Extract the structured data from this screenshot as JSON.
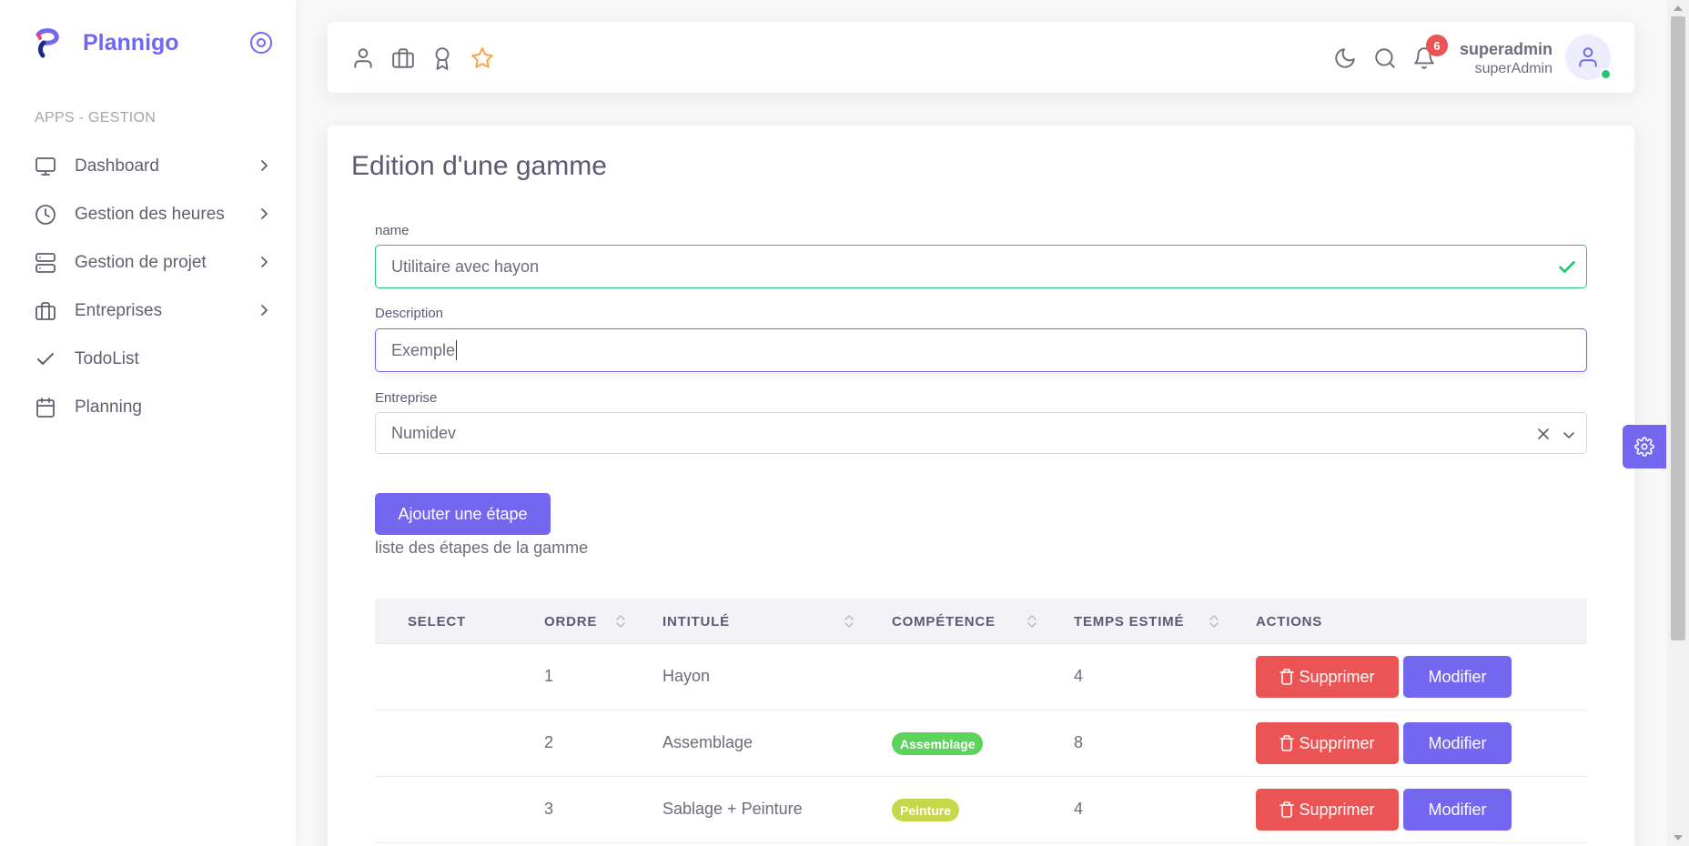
{
  "app": {
    "name": "Plannigo",
    "accent": "#7367f0"
  },
  "sidebar": {
    "section_header": "APPS - GESTION",
    "items": [
      {
        "label": "Dashboard",
        "icon": "monitor-icon",
        "has_children": true
      },
      {
        "label": "Gestion des heures",
        "icon": "clock-icon",
        "has_children": true
      },
      {
        "label": "Gestion de projet",
        "icon": "server-icon",
        "has_children": true
      },
      {
        "label": "Entreprises",
        "icon": "briefcase-icon",
        "has_children": true
      },
      {
        "label": "TodoList",
        "icon": "check-icon",
        "has_children": false
      },
      {
        "label": "Planning",
        "icon": "calendar-icon",
        "has_children": false
      }
    ]
  },
  "navbar": {
    "bookmarks": [
      "user-icon",
      "briefcase-icon",
      "award-icon",
      "star-icon"
    ],
    "notification_count": "6",
    "user": {
      "name": "superadmin",
      "role": "superAdmin",
      "status_color": "#28c76f"
    }
  },
  "form": {
    "title": "Edition d'une gamme",
    "name": {
      "label": "name",
      "value": "Utilitaire avec hayon",
      "valid": true
    },
    "description": {
      "label": "Description",
      "value": "Exemple",
      "focused": true
    },
    "entreprise": {
      "label": "Entreprise",
      "value": "Numidev"
    },
    "add_step_button": "Ajouter une étape",
    "list_caption": "liste des étapes de la gamme"
  },
  "table": {
    "headers": {
      "select": "SELECT",
      "ordre": "ORDRE",
      "intitule": "INTITULÉ",
      "competence": "COMPÉTENCE",
      "temps": "TEMPS ESTIMÉ",
      "actions": "ACTIONS"
    },
    "delete_label": "Supprimer",
    "edit_label": "Modifier",
    "rows": [
      {
        "ordre": "1",
        "intitule": "Hayon",
        "competence": "",
        "competence_color": "",
        "temps": "4"
      },
      {
        "ordre": "2",
        "intitule": "Assemblage",
        "competence": "Assemblage",
        "competence_color": "#5cd35a",
        "temps": "8"
      },
      {
        "ordre": "3",
        "intitule": "Sablage + Peinture",
        "competence": "Peinture",
        "competence_color": "#c6d84a",
        "temps": "4"
      }
    ]
  }
}
